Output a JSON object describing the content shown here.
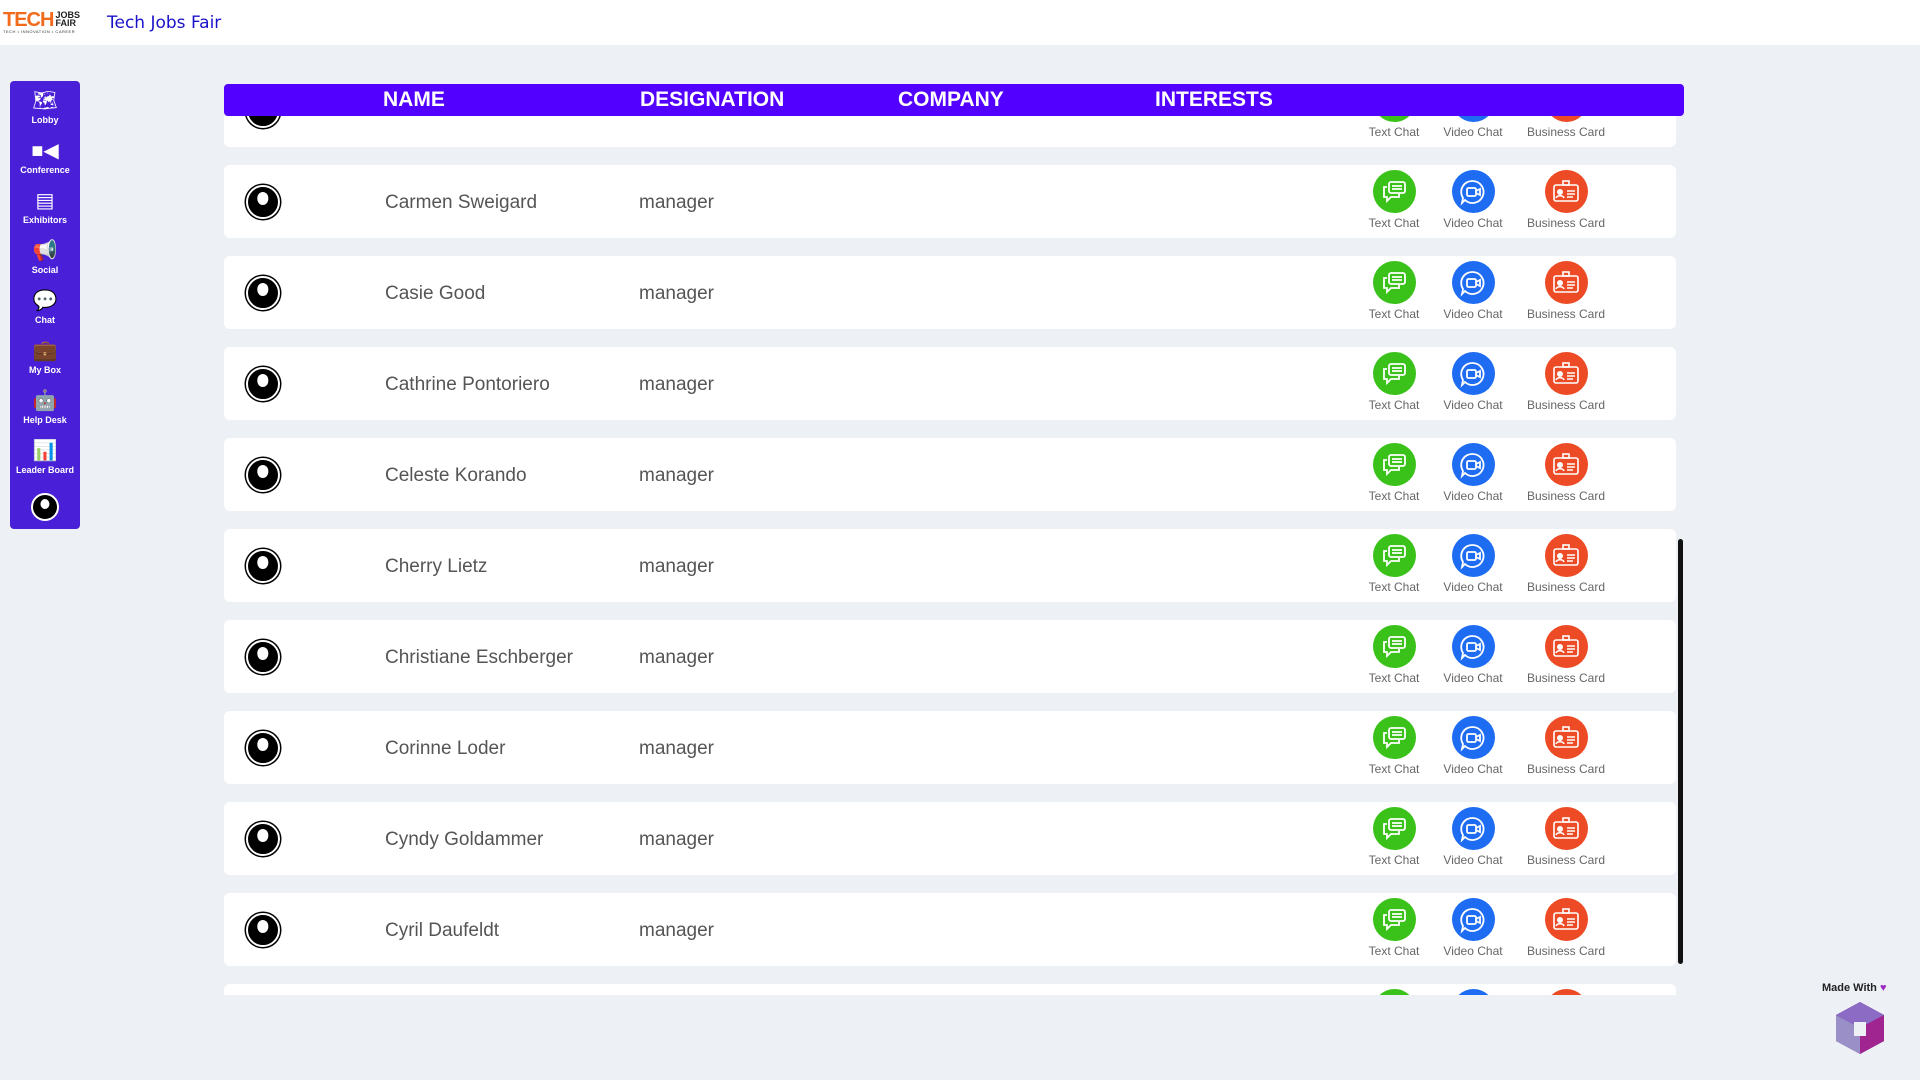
{
  "app": {
    "title": "Tech Jobs Fair",
    "logo_text": "TECH JOBS FAIR",
    "logo_tagline": "TECH • INNOVATION • CAREER"
  },
  "sidebar": {
    "items": [
      {
        "label": "Lobby",
        "icon": "map-icon"
      },
      {
        "label": "Conference",
        "icon": "video-camera-icon"
      },
      {
        "label": "Exhibitors",
        "icon": "booth-icon"
      },
      {
        "label": "Social",
        "icon": "megaphone-icon"
      },
      {
        "label": "Chat",
        "icon": "chat-icon"
      },
      {
        "label": "My Box",
        "icon": "briefcase-icon"
      },
      {
        "label": "Help Desk",
        "icon": "robot-icon"
      },
      {
        "label": "Leader Board",
        "icon": "bar-chart-icon"
      }
    ]
  },
  "table": {
    "headers": [
      "NAME",
      "DESIGNATION",
      "COMPANY",
      "INTERESTS"
    ],
    "actions": {
      "text_chat": "Text Chat",
      "video_chat": "Video Chat",
      "business_card": "Business Card"
    },
    "colors": {
      "header": "#5200ff",
      "text_chat": "#3ac21a",
      "video_chat": "#1e6cf2",
      "business_card": "#ec4b25"
    },
    "rows": [
      {
        "name": "",
        "designation": ""
      },
      {
        "name": "Carmen Sweigard",
        "designation": "manager"
      },
      {
        "name": "Casie Good",
        "designation": "manager"
      },
      {
        "name": "Cathrine Pontoriero",
        "designation": "manager"
      },
      {
        "name": "Celeste Korando",
        "designation": "manager"
      },
      {
        "name": "Cherry Lietz",
        "designation": "manager"
      },
      {
        "name": "Christiane Eschberger",
        "designation": "manager"
      },
      {
        "name": "Corinne Loder",
        "designation": "manager"
      },
      {
        "name": "Cyndy Goldammer",
        "designation": "manager"
      },
      {
        "name": "Cyril Daufeldt",
        "designation": "manager"
      },
      {
        "name": "",
        "designation": ""
      }
    ]
  },
  "footer": {
    "made_with": "Made With"
  }
}
